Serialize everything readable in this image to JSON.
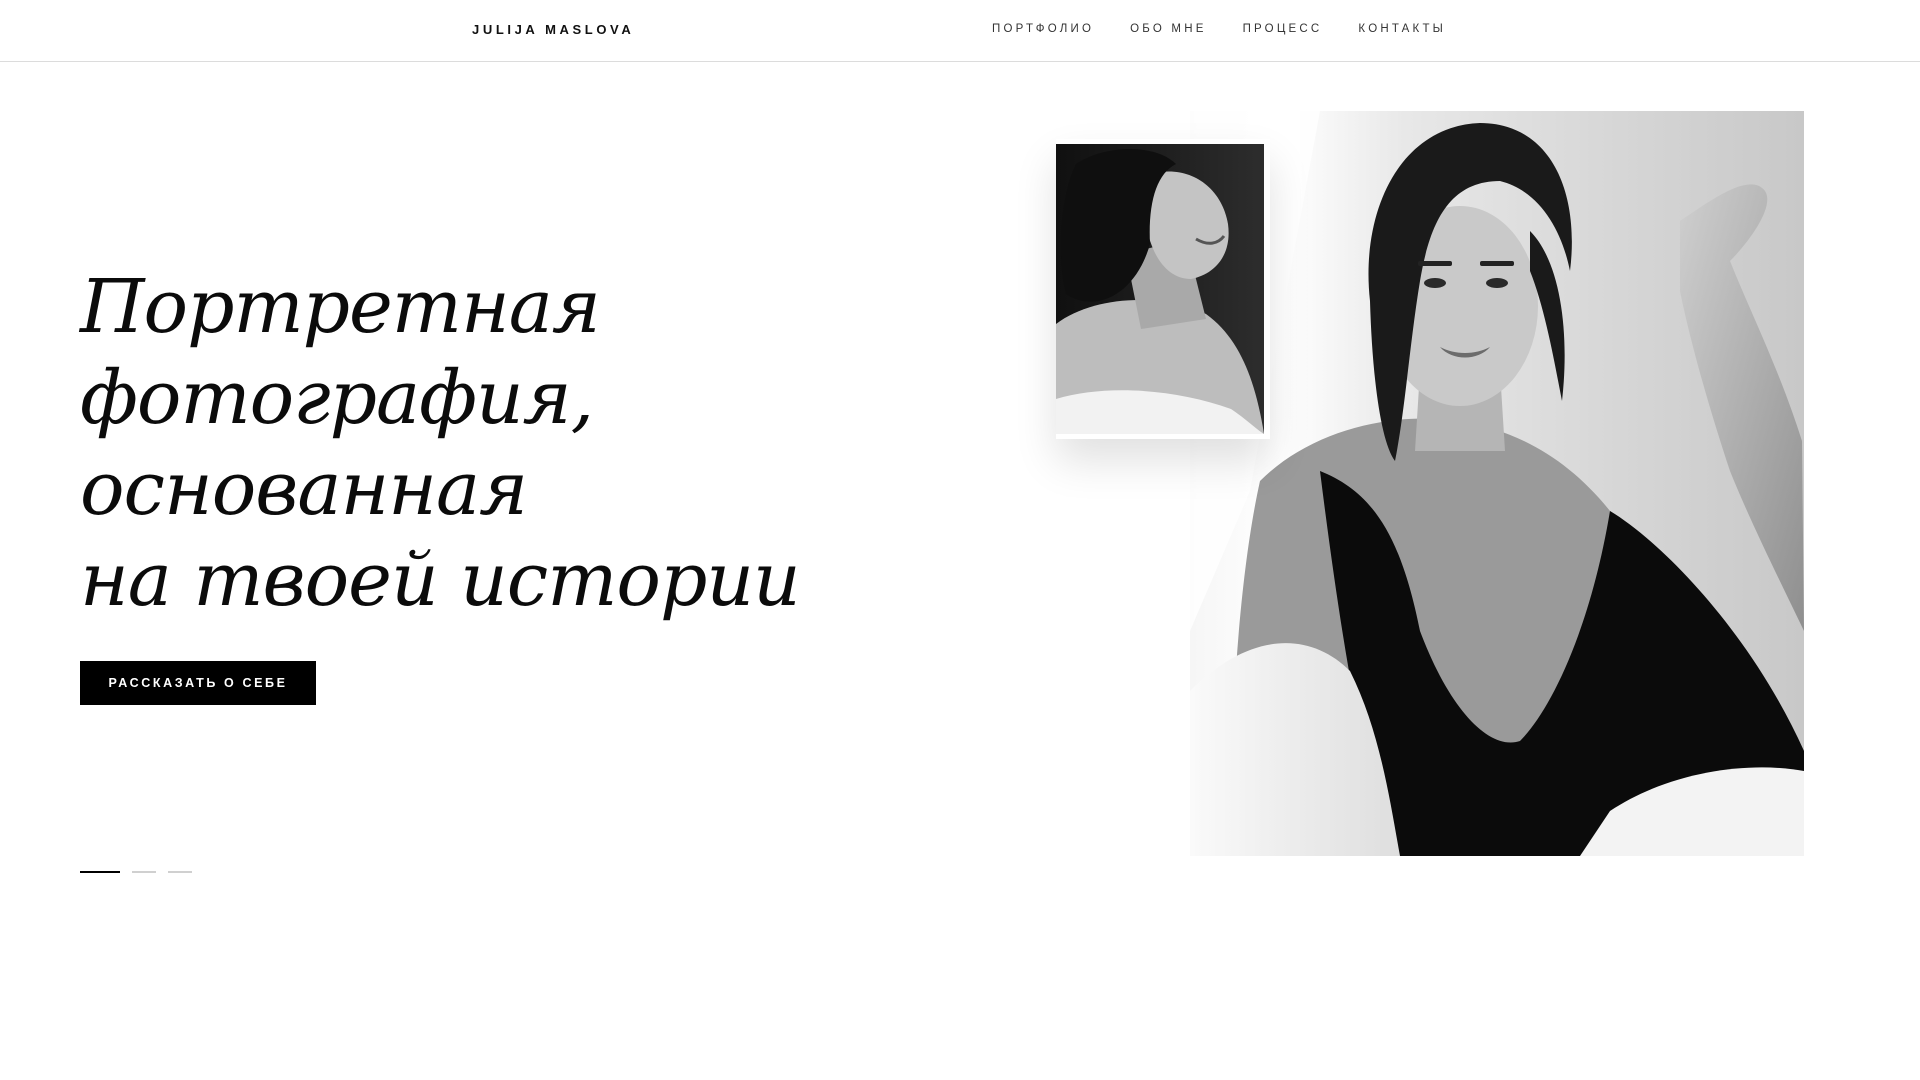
{
  "header": {
    "brand": "JULIJA MASLOVA",
    "nav": [
      "ПОРТФОЛИО",
      "ОБО МНЕ",
      "ПРОЦЕСС",
      "КОНТАКТЫ"
    ]
  },
  "hero": {
    "title_lines": [
      "Портретная",
      "фотография,",
      "основанная",
      "на твоей истории"
    ],
    "cta_label": "РАССКАЗАТЬ О СЕБЕ",
    "slides_count": 3,
    "active_slide": 1
  },
  "images": {
    "main": "black-and-white portrait photo",
    "small": "black-and-white portrait photo"
  },
  "colors": {
    "accent": "#000000",
    "text": "#111111",
    "divider": "#dcdcdc",
    "inactive_dot": "#d0d0d0"
  }
}
